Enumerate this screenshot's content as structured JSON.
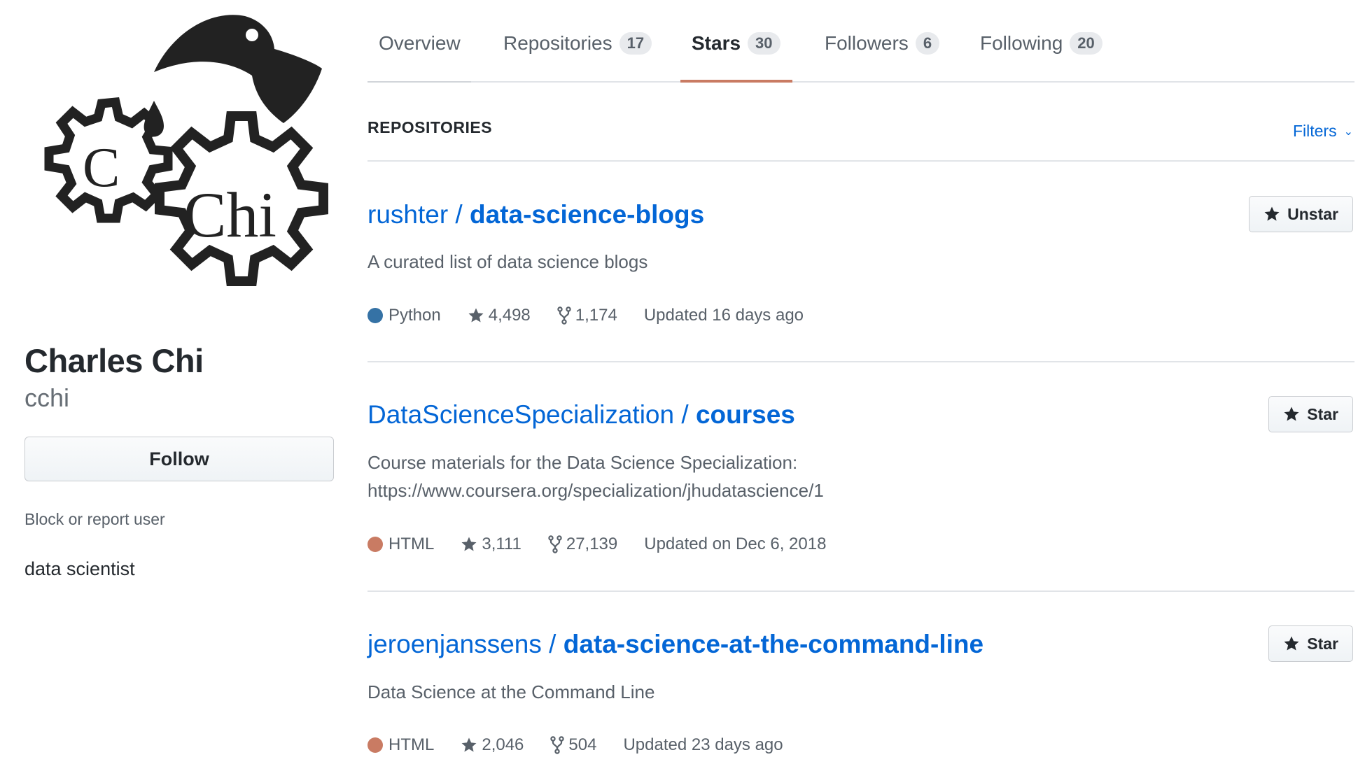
{
  "profile": {
    "avatar_text_small": "C",
    "avatar_text_large": "Chi",
    "fullname": "Charles Chi",
    "username": "cchi",
    "follow_label": "Follow",
    "block_label": "Block or report user",
    "bio": "data scientist"
  },
  "tabs": [
    {
      "label": "Overview",
      "count": ""
    },
    {
      "label": "Repositories",
      "count": "17"
    },
    {
      "label": "Stars",
      "count": "30",
      "active": true
    },
    {
      "label": "Followers",
      "count": "6"
    },
    {
      "label": "Following",
      "count": "20"
    }
  ],
  "section": {
    "title": "REPOSITORIES",
    "filters_label": "Filters"
  },
  "repos": [
    {
      "owner": "rushter",
      "separator": " / ",
      "name": "data-science-blogs",
      "description": "A curated list of data science blogs",
      "language": "Python",
      "language_color": "#3572A5",
      "stars": "4,498",
      "forks": "1,174",
      "updated": "Updated 16 days ago",
      "button_label": "Unstar"
    },
    {
      "owner": "DataScienceSpecialization",
      "separator": " / ",
      "name": "courses",
      "description": "Course materials for the Data Science Specialization:",
      "description_2": "https://www.coursera.org/specialization/jhudatascience/1",
      "language": "HTML",
      "language_color": "#c97b63",
      "stars": "3,111",
      "forks": "27,139",
      "updated": "Updated on Dec 6, 2018",
      "button_label": "Star"
    },
    {
      "owner": "jeroenjanssens",
      "separator": " / ",
      "name": "data-science-at-the-command-line",
      "description": "Data Science at the Command Line",
      "language": "HTML",
      "language_color": "#c97b63",
      "stars": "2,046",
      "forks": "504",
      "updated": "Updated 23 days ago",
      "button_label": "Star"
    }
  ],
  "colors": {
    "link": "#0366d6",
    "active_tab_underline": "#c97b63"
  }
}
